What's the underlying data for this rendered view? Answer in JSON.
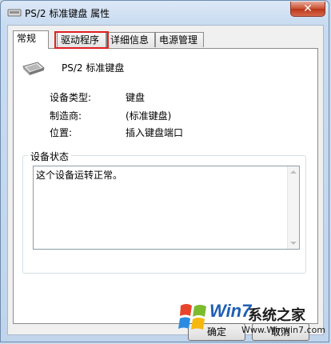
{
  "window": {
    "title": "PS/2 标准键盘 属性",
    "close_label": "✕"
  },
  "tabs": [
    {
      "label": "常规",
      "active": true
    },
    {
      "label": "驱动程序",
      "highlighted": true
    },
    {
      "label": "详细信息"
    },
    {
      "label": "电源管理"
    }
  ],
  "device": {
    "name": "PS/2 标准键盘",
    "properties": [
      {
        "label": "设备类型:",
        "value": "键盘"
      },
      {
        "label": "制造商:",
        "value": "(标准键盘)"
      },
      {
        "label": "位置:",
        "value": "插入键盘端口"
      }
    ]
  },
  "status": {
    "group_title": "设备状态",
    "text": "这个设备运转正常。"
  },
  "footer": {
    "ok_label": "确定",
    "cancel_label": "取消"
  },
  "watermark": {
    "brand": "Win7",
    "name": "系统之家",
    "url": "Www.Winwin7.com"
  },
  "colors": {
    "highlight": "#e02020",
    "title_bg": "#c8dbf0",
    "close_button": "#c9502f"
  }
}
